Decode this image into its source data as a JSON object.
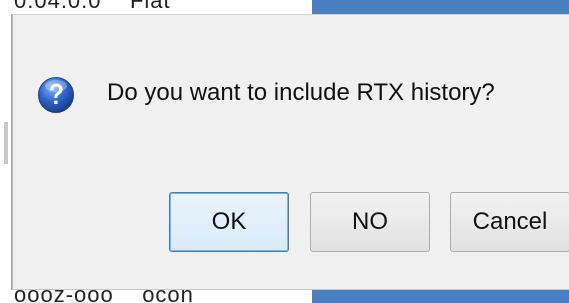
{
  "background": {
    "top_text": "0.04.0.0    Flat",
    "bottom_text": "oooz-ooo    ocon",
    "accent_color": "#4a7ec1"
  },
  "dialog": {
    "icon": "question-icon",
    "message": "Do you want to include RTX history?",
    "buttons": {
      "ok_label": "OK",
      "no_label": "NO",
      "cancel_label": "Cancel"
    },
    "default_button": "OK",
    "default_button_color": "#3c7fb1"
  }
}
